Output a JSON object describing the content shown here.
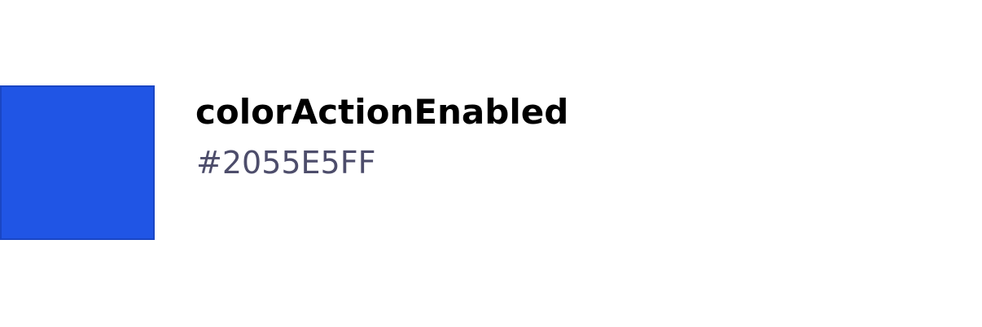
{
  "token": {
    "name": "colorActionEnabled",
    "value": "#2055E5FF",
    "swatch_color": "#2055E5"
  }
}
